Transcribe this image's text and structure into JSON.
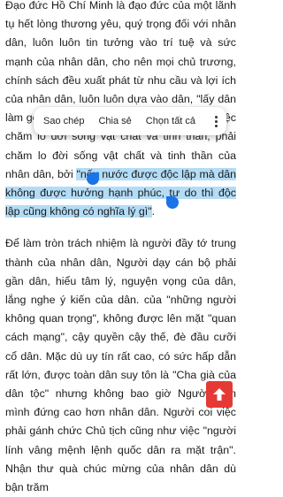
{
  "article": {
    "p1_before": "Đạo đức Hồ Chí Minh là đạo đức của một lãnh tụ hết lòng thương yêu, quý trọng đối với nhân dân, luôn luôn tin tưởng vào trí tuệ và sức mạnh của nhân dân, cho nên mọi chủ trương, chính sách đều xuất phát từ nhu cầu và lợi ích của nhân dân, luôn luôn dựa vào dân, \"lấy dân làm gốc\". Người còn đặc biệt quan tâm tới việc chăm lo đời sống vật chất và tinh thần, phải chăm lo đời sống vật chất và tinh thần của nhân dân, bởi ",
    "p1_selected": "\"nếu nước được độc lập mà dân không được hưởng hạnh phúc, tự do thì độc lập cũng không có nghĩa lý gì\"",
    "p1_after": ".",
    "p2": "Để làm tròn trách nhiệm là người đầy tớ trung thành của nhân dân, Người dạy cán bộ phải gần dân, hiểu tâm lý, nguyện vọng của dân, lắng nghe ý kiến của dân. của \"những người không quan trọng\", không được lên mặt \"quan cách mạng\", cậy quyền cậy thế, đè đầu cưỡi cổ dân. Mặc dù uy tín rất cao, có sức hấp dẫn rất lớn, được toàn dân suy tôn là \"Cha già của dân tộc\" nhưng không bao giờ Người xem mình đứng cao hơn nhân dân. Người coi việc phải gánh chức Chủ tịch cũng như việc \"người lính vâng mệnh lệnh quốc dân ra mặt trận\". Nhận thư quà chúc mừng của nhân dân dù bận trăm"
  },
  "context_menu": {
    "copy": "Sao chép",
    "share": "Chia sẻ",
    "select_all": "Chọn tất cả",
    "more_icon": "more-vert-icon"
  },
  "scroll_top": {
    "icon": "arrow-up-icon",
    "color": "#e53935"
  },
  "colors": {
    "selection": "#b3dcf6",
    "handle": "#1a73e8"
  }
}
